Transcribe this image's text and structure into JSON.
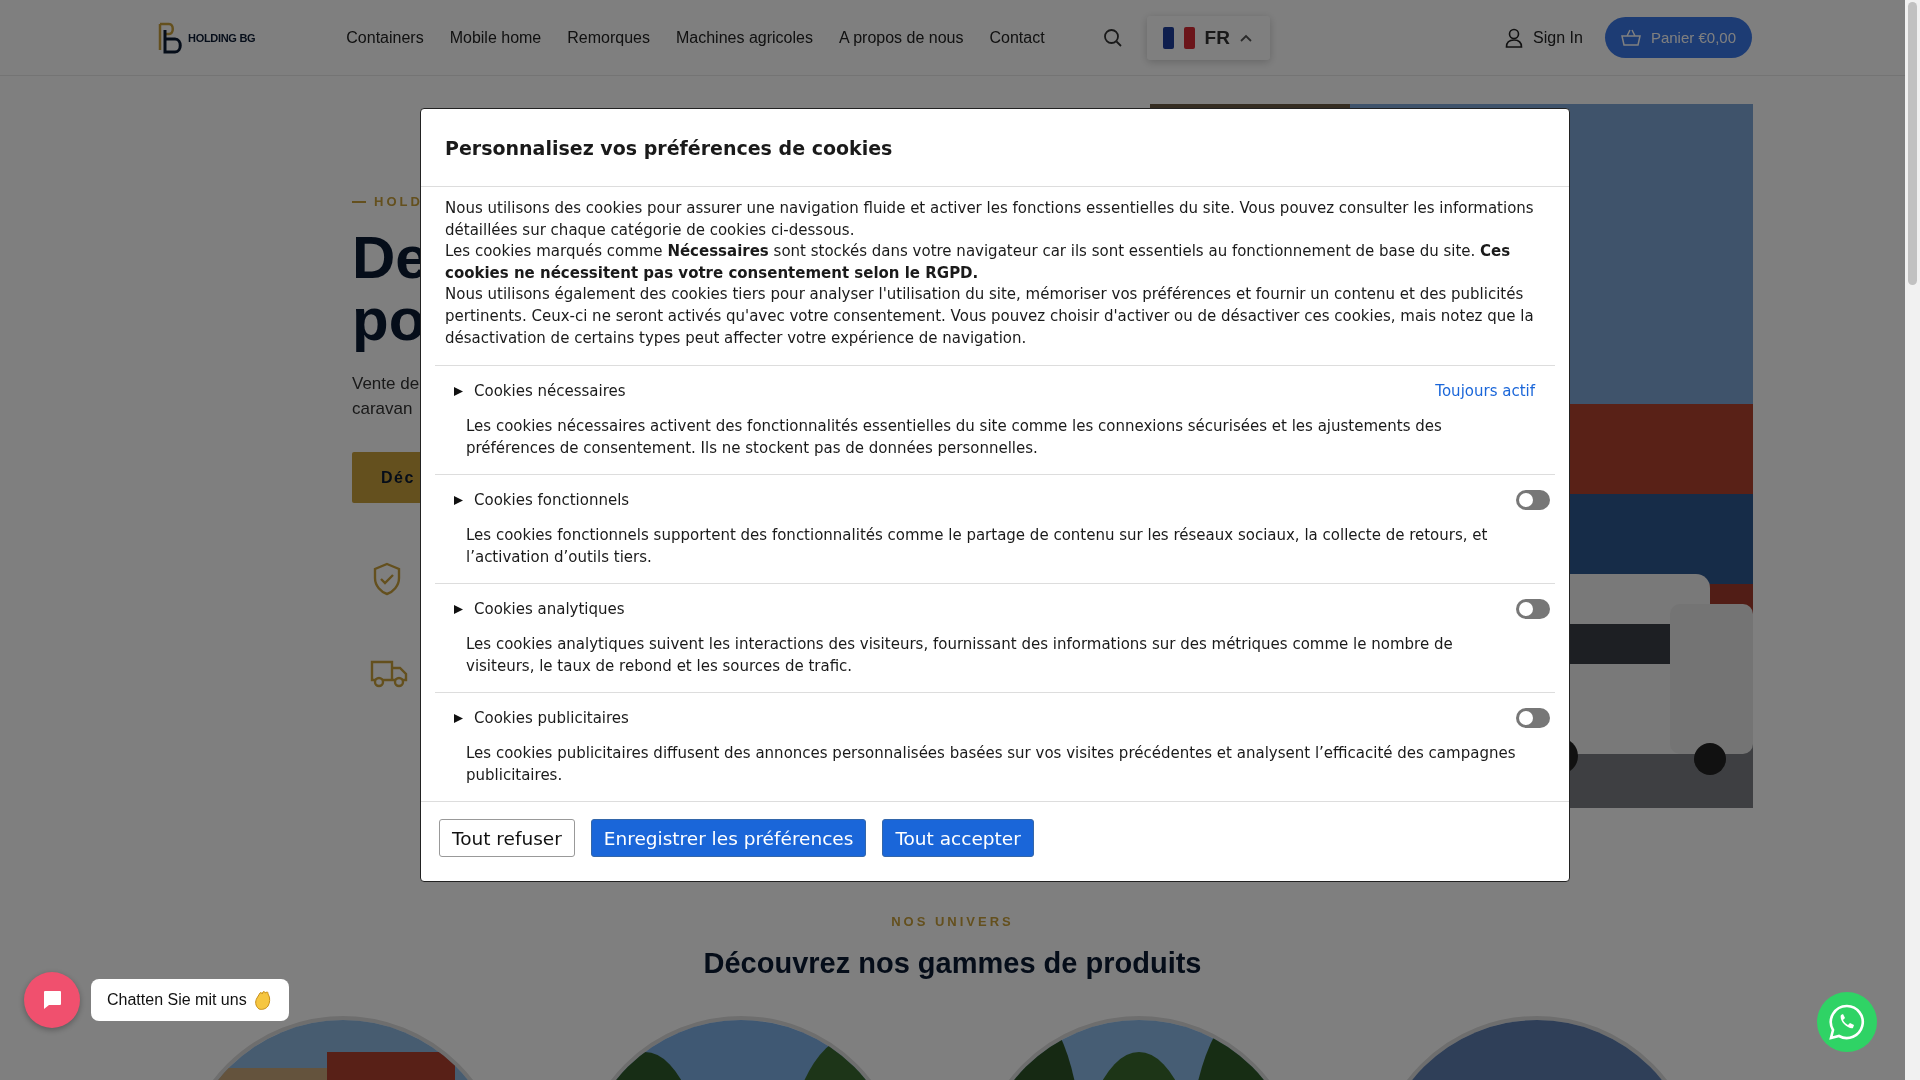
{
  "header": {
    "logo": "HOLDING BG",
    "nav": [
      "Containers",
      "Mobile home",
      "Remorques",
      "Machines agricoles",
      "A propos de nous",
      "Contact"
    ],
    "language": {
      "code": "FR",
      "expanded": true
    },
    "sign_in": "Sign In",
    "cart": "Panier €0,00"
  },
  "hero": {
    "eyebrow": "HOLD",
    "title_lines": [
      "De",
      "po"
    ],
    "subtitle_lines": [
      "Vente de",
      "caravan"
    ],
    "button": "Déc",
    "image": {
      "kind": "picture"
    }
  },
  "products": {
    "eyebrow": "NOS UNIVERS",
    "title": "Découvrez nos gammes de produits",
    "cards": [
      {
        "kind": "picture"
      },
      {
        "kind": "picture"
      },
      {
        "kind": "picture"
      },
      {
        "kind": "picture"
      }
    ]
  },
  "cookie_modal": {
    "title": "Personnalisez vos préférences de cookies",
    "paragraphs": [
      "Nous utilisons des cookies pour assurer une navigation fluide et activer les fonctions essentielles du site. Vous pouvez consulter les informations détaillées sur chaque catégorie de cookies ci-dessous.",
      "Les cookies marqués comme **Nécessaires** sont stockés dans votre navigateur car ils sont essentiels au fonctionnement de base du site. **Ces cookies ne nécessitent pas votre consentement selon le RGPD.**",
      "Nous utilisons également des cookies tiers pour analyser l'utilisation du site, mémoriser vos préférences et fournir un contenu et des publicités pertinents. Ceux-ci ne seront activés qu'avec votre consentement. Vous pouvez choisir d'activer ou de désactiver ces cookies, mais notez que la désactivation de certains types peut affecter votre expérience de navigation."
    ],
    "categories": [
      {
        "kind": "always",
        "title": "Cookies nécessaires",
        "status": "Toujours actif",
        "description": "Les cookies nécessaires activent des fonctionnalités essentielles du site comme les connexions sécurisées et les ajustements des préférences de consentement. Ils ne stockent pas de données personnelles."
      },
      {
        "kind": "toggle",
        "title": "Cookies fonctionnels",
        "on": false,
        "description": "Les cookies fonctionnels supportent des fonctionnalités comme le partage de contenu sur les réseaux sociaux, la collecte de retours, et l’activation d’outils tiers."
      },
      {
        "kind": "toggle",
        "title": "Cookies analytiques",
        "on": false,
        "description": "Les cookies analytiques suivent les interactions des visiteurs, fournissant des informations sur des métriques comme le nombre de visiteurs, le taux de rebond et les sources de trafic."
      },
      {
        "kind": "toggle",
        "title": "Cookies publicitaires",
        "on": false,
        "description": "Les cookies publicitaires diffusent des annonces personnalisées basées sur vos visites précédentes et analysent l’efficacité des campagnes publicitaires."
      }
    ],
    "buttons": [
      {
        "kind": "secondary",
        "label": "Tout refuser"
      },
      {
        "kind": "primary",
        "label": "Enregistrer les préférences"
      },
      {
        "kind": "primary",
        "label": "Tout accepter"
      }
    ]
  },
  "chat": {
    "label": "Chatten Sie mit uns"
  }
}
